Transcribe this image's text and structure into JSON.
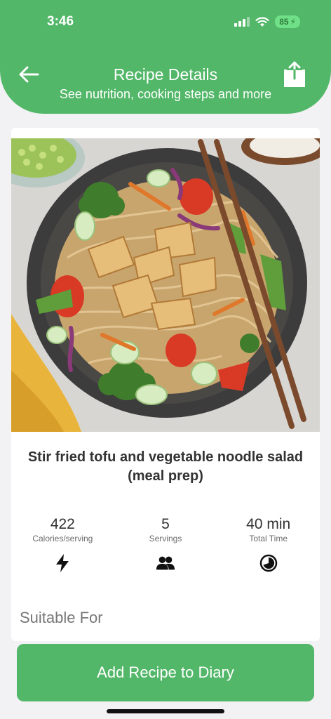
{
  "status_bar": {
    "time": "3:46",
    "battery": "85"
  },
  "header": {
    "title": "Recipe Details",
    "subtitle": "See nutrition, cooking steps and more",
    "color": "#52b768"
  },
  "recipe": {
    "name": "Stir fried tofu and vegetable noodle salad (meal prep)",
    "image_icon": "noodle-bowl-photo"
  },
  "stats": [
    {
      "value": "422",
      "label": "Calories/serving",
      "icon": "lightning-icon"
    },
    {
      "value": "5",
      "label": "Servings",
      "icon": "people-icon"
    },
    {
      "value": "40 min",
      "label": "Total Time",
      "icon": "timer-icon"
    }
  ],
  "sections": {
    "suitable_for": "Suitable For"
  },
  "actions": {
    "add_to_diary": "Add Recipe to Diary"
  }
}
